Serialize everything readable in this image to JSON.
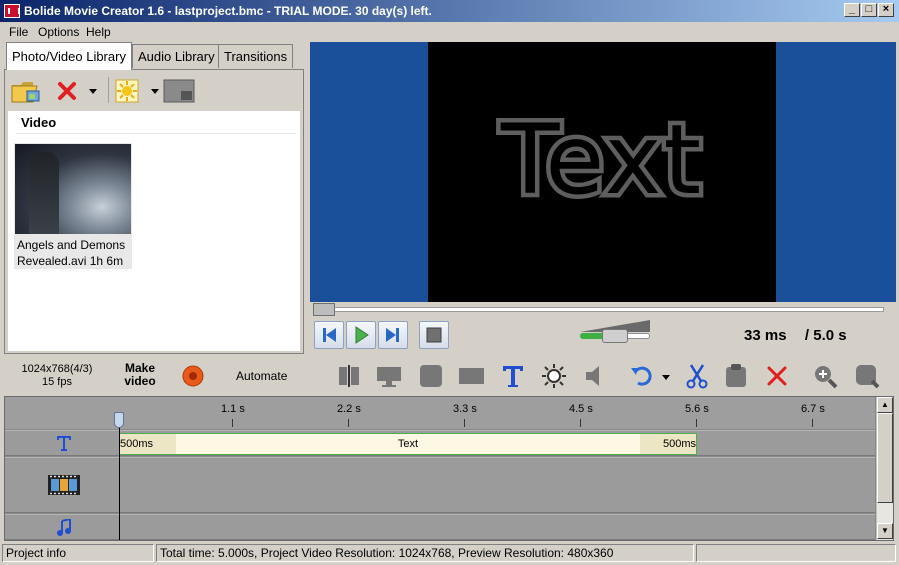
{
  "window": {
    "title": "Bolide Movie Creator 1.6 - lastproject.bmc  - TRIAL MODE. 30 day(s) left.",
    "min": "_",
    "max": "□",
    "close": "×"
  },
  "menu": [
    "File",
    "Options",
    "Help"
  ],
  "library": {
    "tabs": [
      "Photo/Video Library",
      "Audio Library",
      "Transitions"
    ],
    "section_title": "Video",
    "items": [
      {
        "name_line1": "Angels and Demons",
        "name_line2": "Revealed.avi 1h 6m"
      }
    ]
  },
  "preview": {
    "overlay_text": "Text",
    "current_time": "33 ms",
    "total_time": "/ 5.0 s"
  },
  "toolbar": {
    "resolution": "1024x768(4/3)",
    "fps": "15 fps",
    "make_video_line1": "Make",
    "make_video_line2": "video",
    "automate": "Automate"
  },
  "timeline": {
    "ruler_labels": [
      "1.1 s",
      "2.2 s",
      "3.3 s",
      "4.5 s",
      "5.6 s",
      "6.7 s"
    ],
    "text_clip": {
      "label": "Text",
      "fade_in": "500ms",
      "fade_out": "500ms"
    }
  },
  "statusbar": {
    "project_info": "Project info",
    "details": "Total time: 5.000s,    Project Video Resolution:    1024x768,    Preview Resolution:    480x360"
  },
  "colors": {
    "title_bar": "#0a246a",
    "preview_bg": "#1a4f9a",
    "clip_border": "#4caf50",
    "accent_blue": "#1f4fd0"
  }
}
